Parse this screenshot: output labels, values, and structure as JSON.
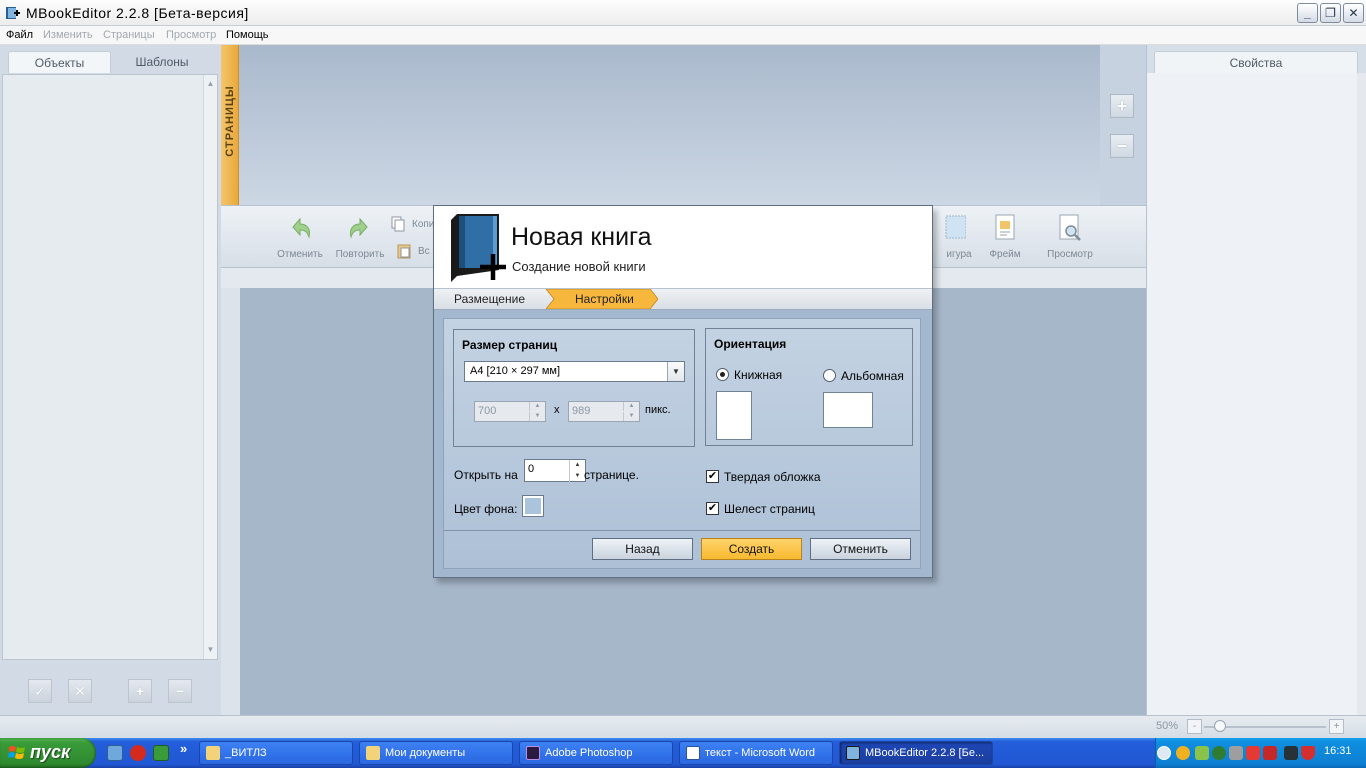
{
  "window": {
    "title": "MBookEditor 2.2.8 [Бета-версия]",
    "controls": {
      "minimize": "_",
      "maximize": "❐",
      "close": "✕"
    }
  },
  "menu": {
    "file": "Файл",
    "edit": "Изменить",
    "pages": "Страницы",
    "view": "Просмотр",
    "help": "Помощь"
  },
  "left_panel": {
    "tabs": {
      "objects": "Объекты",
      "templates": "Шаблоны"
    },
    "buttons": {
      "confirm": "✓",
      "remove": "✕",
      "add": "+",
      "minus": "−"
    }
  },
  "pages_strip": {
    "label": "СТРАНИЦЫ",
    "zoom_in": "+",
    "zoom_out": "−"
  },
  "toolbar": {
    "undo": "Отменить",
    "redo": "Повторить",
    "copy": "Копи",
    "paste": "Вс",
    "shape": "игура",
    "frame": "Фрейм",
    "preview": "Просмотр"
  },
  "right_panel": {
    "tab": "Свойства"
  },
  "statusbar": {
    "zoom": "50%",
    "zoom_minus": "-",
    "zoom_plus": "+"
  },
  "dialog": {
    "title": "Новая книга",
    "subtitle": "Создание новой книги",
    "steps": {
      "placement": "Размещение",
      "settings": "Настройки"
    },
    "page_size": {
      "title": "Размер страниц",
      "selected": "A4 [210 × 297 мм]",
      "width": "700",
      "height": "989",
      "times": "x",
      "unit": "пикс."
    },
    "orientation": {
      "title": "Ориентация",
      "portrait": "Книжная",
      "landscape": "Альбомная",
      "selected": "portrait"
    },
    "open_on": {
      "label": "Открыть на",
      "value": "0",
      "suffix": "странице."
    },
    "background": {
      "label": "Цвет фона:",
      "color": "#a9c4dc"
    },
    "hard_cover": {
      "label": "Твердая обложка",
      "checked": "✔"
    },
    "page_rustle": {
      "label": "Шелест страниц",
      "checked": "✔"
    },
    "buttons": {
      "back": "Назад",
      "create": "Создать",
      "cancel": "Отменить"
    }
  },
  "taskbar": {
    "start": "пуск",
    "more": "»",
    "tasks": [
      {
        "label": "_ВИТЛЗ"
      },
      {
        "label": "Мои документы"
      },
      {
        "label": "Adobe Photoshop"
      },
      {
        "label": "текст - Microsoft Word"
      },
      {
        "label": "MBookEditor 2.2.8 [Бе..."
      }
    ],
    "clock": "16:31"
  },
  "colors": {
    "accent_orange": "#f7b92f",
    "dialog_bg": "#a3b7cf",
    "taskbar_blue": "#245edb"
  }
}
